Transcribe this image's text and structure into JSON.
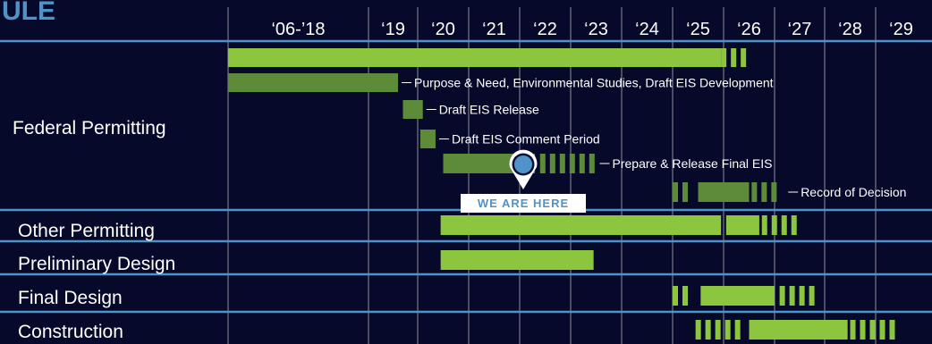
{
  "heading": "ULE",
  "marker": {
    "label": "WE ARE HERE",
    "x": "2022"
  },
  "colors": {
    "background": "#06092a",
    "bright_green": "#8cc63f",
    "dark_green": "#5e8b3a",
    "separator_blue": "#4f93c8",
    "grid": "#ffffff"
  },
  "chart_data": {
    "type": "gantt",
    "x_axis": {
      "ticks": [
        "‘06-’18",
        "‘19",
        "‘20",
        "‘21",
        "‘22",
        "‘23",
        "‘24",
        "‘25",
        "‘26",
        "‘27",
        "‘28",
        "‘29"
      ],
      "first_period": "2006–2018",
      "last_period": "2029"
    },
    "row_labels": [
      "Federal Permitting",
      "Other Permitting",
      "Preliminary Design",
      "Final Design",
      "Construction"
    ],
    "tasks": [
      {
        "row": "Federal Permitting",
        "label": "",
        "color": "bright",
        "segments": [
          {
            "kind": "solid",
            "start": "2006",
            "end": "2025.95"
          },
          {
            "kind": "dashed",
            "start": "2025.95",
            "end": "2026.5"
          }
        ]
      },
      {
        "row": "Federal Permitting",
        "label": "Purpose & Need, Environmental Studies,  Draft EIS Development",
        "color": "dark",
        "segments": [
          {
            "kind": "solid",
            "start": "2006",
            "end": "2019.6"
          }
        ]
      },
      {
        "row": "Federal Permitting",
        "label": "Draft EIS Release",
        "color": "dark",
        "segments": [
          {
            "kind": "solid",
            "start": "2019.7",
            "end": "2020.1"
          }
        ]
      },
      {
        "row": "Federal Permitting",
        "label": "Draft EIS Comment Period",
        "color": "dark",
        "segments": [
          {
            "kind": "solid",
            "start": "2020.05",
            "end": "2020.35"
          }
        ]
      },
      {
        "row": "Federal Permitting",
        "label": "Prepare & Release Final EIS",
        "color": "dark",
        "segments": [
          {
            "kind": "solid",
            "start": "2020.5",
            "end": "2022.3"
          },
          {
            "kind": "dashed",
            "start": "2022.4",
            "end": "2023.5"
          }
        ]
      },
      {
        "row": "Federal Permitting",
        "label": "Record of Decision",
        "color": "dark",
        "segments": [
          {
            "kind": "dashed",
            "start": "2025.0",
            "end": "2025.45"
          },
          {
            "kind": "solid",
            "start": "2025.5",
            "end": "2026.5"
          },
          {
            "kind": "dashed",
            "start": "2026.55",
            "end": "2027.2"
          }
        ]
      },
      {
        "row": "Other Permitting",
        "label": "",
        "color": "bright",
        "segments": [
          {
            "kind": "solid",
            "start": "2020.45",
            "end": "2025.95"
          },
          {
            "kind": "solid",
            "start": "2026.05",
            "end": "2026.7"
          },
          {
            "kind": "dashed",
            "start": "2026.75",
            "end": "2027.6"
          }
        ]
      },
      {
        "row": "Preliminary Design",
        "label": "",
        "color": "bright",
        "segments": [
          {
            "kind": "solid",
            "start": "2020.45",
            "end": "2023.45"
          }
        ]
      },
      {
        "row": "Final Design",
        "label": "",
        "color": "bright",
        "segments": [
          {
            "kind": "dashed",
            "start": "2025.0",
            "end": "2025.45"
          },
          {
            "kind": "solid",
            "start": "2025.55",
            "end": "2027.0"
          },
          {
            "kind": "dashed",
            "start": "2027.1",
            "end": "2027.95"
          }
        ]
      },
      {
        "row": "Construction",
        "label": "",
        "color": "bright",
        "segments": [
          {
            "kind": "dashed",
            "start": "2025.45",
            "end": "2026.45"
          },
          {
            "kind": "solid",
            "start": "2026.5",
            "end": "2028.45"
          },
          {
            "kind": "dashed",
            "start": "2028.5",
            "end": "2029.4"
          }
        ]
      }
    ]
  }
}
